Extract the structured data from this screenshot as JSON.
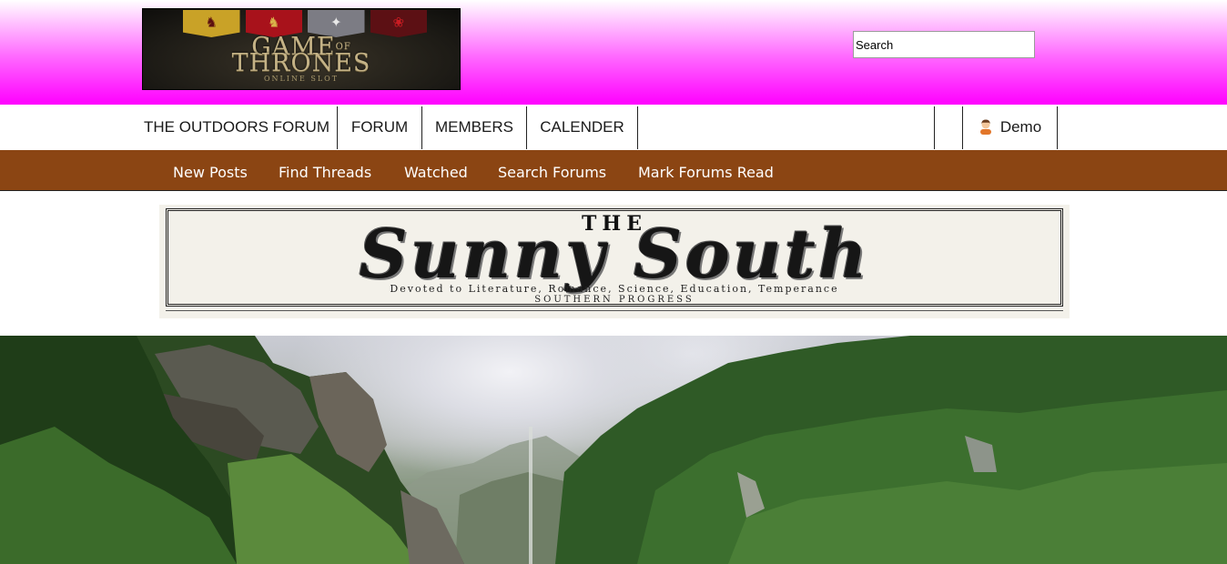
{
  "header": {
    "logo": {
      "title_line1": "GAME",
      "title_of": "OF",
      "title_line2": "THRONES",
      "subtitle": "ONLINE SLOT",
      "banner_colors": [
        "#c9a227",
        "#a8121b",
        "#7c7c84",
        "#5c1014"
      ]
    },
    "search": {
      "placeholder": "Search"
    }
  },
  "main_nav": {
    "items": [
      {
        "label": "THE OUTDOORS FORUM"
      },
      {
        "label": "FORUM"
      },
      {
        "label": "MEMBERS"
      },
      {
        "label": "CALENDER"
      }
    ],
    "user": {
      "label": "Demo",
      "icon": "user-icon"
    }
  },
  "sub_nav": {
    "items": [
      {
        "label": "New Posts"
      },
      {
        "label": "Find Threads"
      },
      {
        "label": "Watched"
      },
      {
        "label": "Search Forums"
      },
      {
        "label": "Mark Forums Read"
      }
    ]
  },
  "ad_banner": {
    "the": "THE",
    "title": "Sunny South",
    "subtitle": "Devoted to Literature, Romance, Science, Education, Temperance",
    "subtitle2": "SOUTHERN PROGRESS"
  },
  "colors": {
    "header_gradient_end": "#ff00ff",
    "subnav_background": "#8b4513",
    "subnav_text": "#ffffff"
  }
}
